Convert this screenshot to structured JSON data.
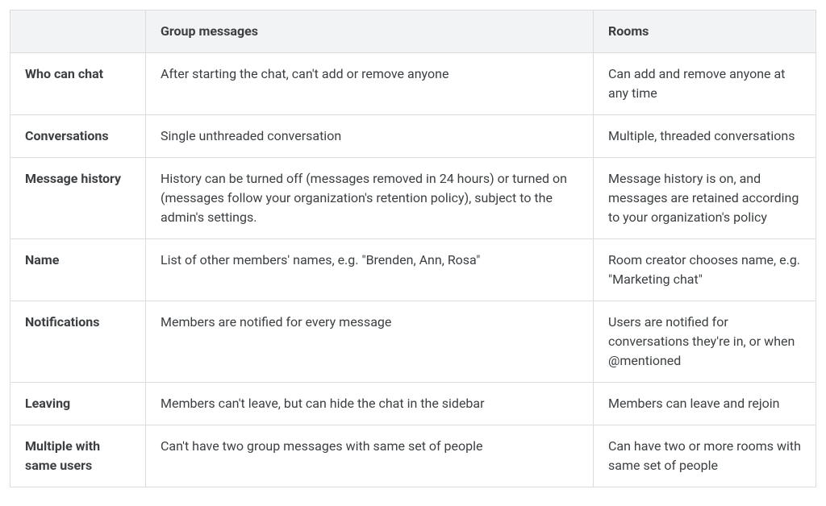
{
  "table": {
    "headers": {
      "col0": "",
      "col1": "Group messages",
      "col2": "Rooms"
    },
    "rows": [
      {
        "label": "Who can chat",
        "group": "After starting the chat, can't add or remove anyone",
        "rooms": "Can add and remove anyone at any time"
      },
      {
        "label": "Conversations",
        "group": "Single unthreaded conversation",
        "rooms": "Multiple, threaded conversations"
      },
      {
        "label": "Message history",
        "group": "History can be turned off (messages removed in 24 hours) or turned on (messages follow your organization's retention policy), subject to the admin's settings.",
        "rooms": "Message history is on, and messages are retained according to your organization's policy"
      },
      {
        "label": "Name",
        "group": "List of other members' names, e.g. \"Brenden, Ann, Rosa\"",
        "rooms": "Room creator chooses name, e.g. \"Marketing chat\""
      },
      {
        "label": "Notifications",
        "group": "Members are notified for every message",
        "rooms": "Users are notified for conversations they're in, or when @mentioned"
      },
      {
        "label": "Leaving",
        "group": "Members can't leave, but can hide the chat in the sidebar",
        "rooms": "Members can leave and rejoin"
      },
      {
        "label": "Multiple with same users",
        "group": "Can't have two group messages with same set of people",
        "rooms": "Can have two or more rooms with same set of people"
      }
    ]
  }
}
